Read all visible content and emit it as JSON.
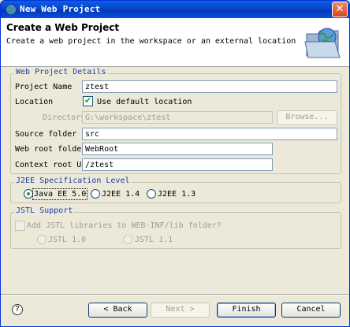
{
  "window": {
    "title": "New Web Project",
    "close_glyph": "✕",
    "icon": "globe-icon"
  },
  "banner": {
    "title": "Create a Web Project",
    "description": "Create a web project in the workspace or an external location",
    "icon": "globe-folder-icon"
  },
  "details": {
    "group_title": "Web Project Details",
    "project_name_label": "Project Name",
    "project_name_value": "ztest",
    "location_label": "Location",
    "use_default_label": "Use default location",
    "use_default_checked": true,
    "directory_label": "Directory",
    "directory_value": "G:\\workspace\\ztest",
    "browse_label": "Browse...",
    "source_folder_label": "Source folder",
    "source_folder_value": "src",
    "web_root_label": "Web root folder",
    "web_root_value": "WebRoot",
    "context_root_label": "Context root URL",
    "context_root_value": "/ztest"
  },
  "j2ee": {
    "group_title": "J2EE Specification Level",
    "options": [
      "Java EE 5.0",
      "J2EE 1.4",
      "J2EE 1.3"
    ],
    "selected": "Java EE 5.0"
  },
  "jstl": {
    "group_title": "JSTL Support",
    "add_label": "Add JSTL libraries to WEB-INF/lib folder?",
    "options": [
      "JSTL 1.0",
      "JSTL 1.1"
    ]
  },
  "footer": {
    "help_glyph": "?",
    "back_label": "< Back",
    "next_label": "Next >",
    "finish_label": "Finish",
    "cancel_label": "Cancel"
  },
  "colors": {
    "title_bar": "#0a4fe0",
    "group_title": "#1f3ea6",
    "check_mark": "#21a121"
  }
}
